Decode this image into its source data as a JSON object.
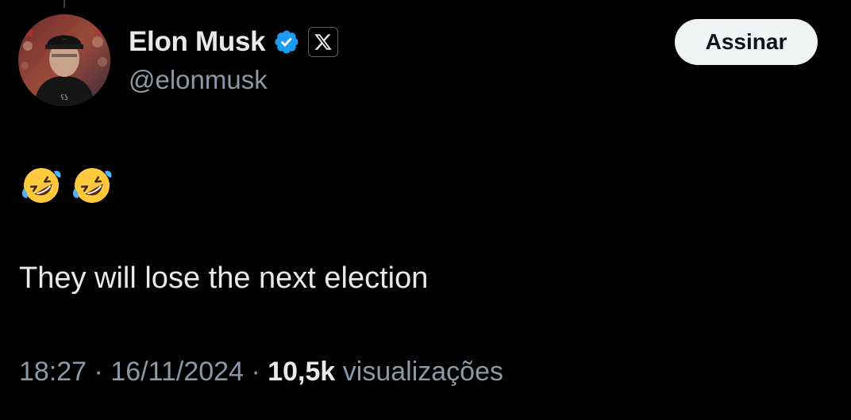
{
  "author": {
    "display_name": "Elon Musk",
    "handle": "@elonmusk",
    "avatar_icon": "profile-photo",
    "verified_icon": "verified-badge-icon",
    "affiliate_icon": "x-logo-icon"
  },
  "subscribe_label": "Assinar",
  "tweet": {
    "emojis": [
      "rolling-on-floor-laughing",
      "rolling-on-floor-laughing"
    ],
    "text": "They will lose the next election"
  },
  "meta": {
    "time": "18:27",
    "separator": "·",
    "date": "16/11/2024",
    "views_count": "10,5k",
    "views_label": "visualizações"
  },
  "colors": {
    "background": "#000000",
    "text_primary": "#e7e9ea",
    "text_secondary": "#8b98a5",
    "verified_blue": "#1d9bf0",
    "button_bg": "#eff3f4"
  }
}
